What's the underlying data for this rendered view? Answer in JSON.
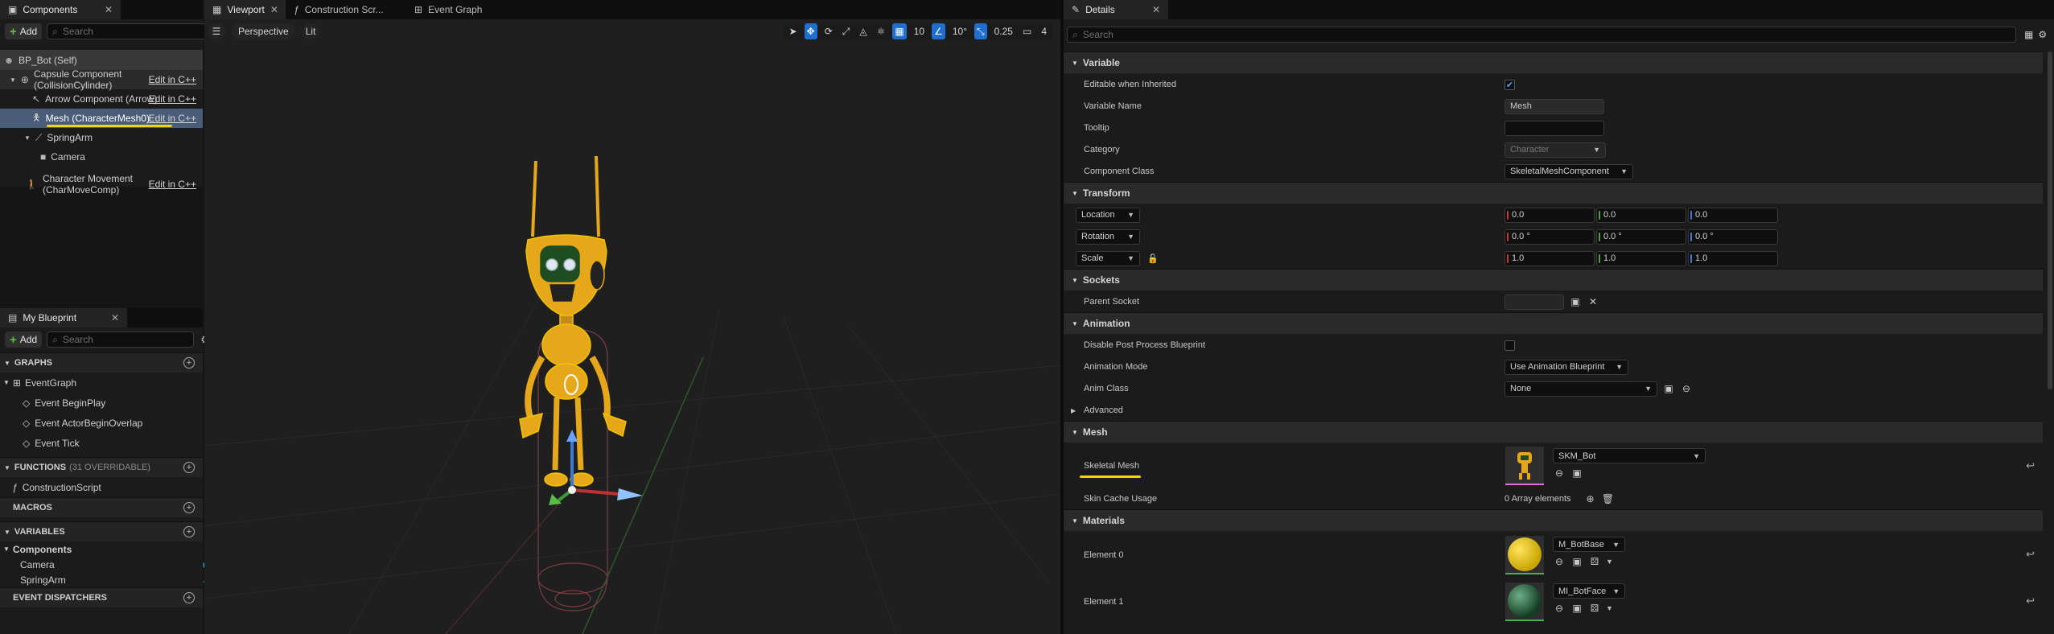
{
  "components_panel": {
    "tab_title": "Components",
    "add_label": "Add",
    "search_placeholder": "Search",
    "edit_label": "Edit in C++",
    "tree": [
      {
        "label": "BP_Bot (Self)"
      },
      {
        "label": "Capsule Component (CollisionCylinder)"
      },
      {
        "label": "Arrow Component (Arrow)"
      },
      {
        "label": "Mesh (CharacterMesh0)"
      },
      {
        "label": "SpringArm"
      },
      {
        "label": "Camera"
      },
      {
        "label": "Character Movement (CharMoveComp)"
      }
    ]
  },
  "blueprint_panel": {
    "tab_title": "My Blueprint",
    "add_label": "Add",
    "search_placeholder": "Search",
    "graphs_header": "GRAPHS",
    "event_graph": "EventGraph",
    "events": [
      "Event BeginPlay",
      "Event ActorBeginOverlap",
      "Event Tick"
    ],
    "functions_header": "FUNCTIONS",
    "functions_note": "(31 OVERRIDABLE)",
    "functions": [
      "ConstructionScript"
    ],
    "macros_header": "MACROS",
    "variables_header": "VARIABLES",
    "variables_group": "Components",
    "variables": [
      "Camera",
      "SpringArm"
    ],
    "dispatchers_header": "EVENT DISPATCHERS"
  },
  "editor_tabs": [
    "Viewport",
    "Construction Scr...",
    "Event Graph"
  ],
  "viewport": {
    "view_mode": "Perspective",
    "lighting": "Lit",
    "grid_size": "10",
    "rotation_snap": "10°",
    "scale_snap": "0.25",
    "camera_speed": "4"
  },
  "details": {
    "tab_title": "Details",
    "search_placeholder": "Search",
    "variable": {
      "header": "Variable",
      "editable_label": "Editable when Inherited",
      "editable_checked": true,
      "name_label": "Variable Name",
      "name_value": "Mesh",
      "tooltip_label": "Tooltip",
      "category_label": "Category",
      "category_value": "Character",
      "component_class_label": "Component Class",
      "component_class_value": "SkeletalMeshComponent"
    },
    "transform": {
      "header": "Transform",
      "location_label": "Location",
      "rotation_label": "Rotation",
      "scale_label": "Scale",
      "location": [
        "0.0",
        "0.0",
        "0.0"
      ],
      "rotation": [
        "0.0 °",
        "0.0 °",
        "0.0 °"
      ],
      "scale": [
        "1.0",
        "1.0",
        "1.0"
      ]
    },
    "sockets": {
      "header": "Sockets",
      "parent_socket_label": "Parent Socket"
    },
    "animation": {
      "header": "Animation",
      "disable_pp_label": "Disable Post Process Blueprint",
      "mode_label": "Animation Mode",
      "mode_value": "Use Animation Blueprint",
      "anim_class_label": "Anim Class",
      "anim_class_value": "None",
      "advanced_label": "Advanced"
    },
    "mesh": {
      "header": "Mesh",
      "skeletal_mesh_label": "Skeletal Mesh",
      "skeletal_mesh_value": "SKM_Bot",
      "skin_cache_label": "Skin Cache Usage",
      "skin_cache_value": "0 Array elements"
    },
    "materials": {
      "header": "Materials",
      "elements": [
        {
          "label": "Element 0",
          "value": "M_BotBase"
        },
        {
          "label": "Element 1",
          "value": "MI_BotFace"
        }
      ]
    }
  },
  "colors": {
    "accent": "#1f6fd1",
    "selection": "#4a5d78",
    "highlight_underline": "#f3d400",
    "robot_body": "#e6a81a",
    "robot_face": "#1e4d22"
  }
}
